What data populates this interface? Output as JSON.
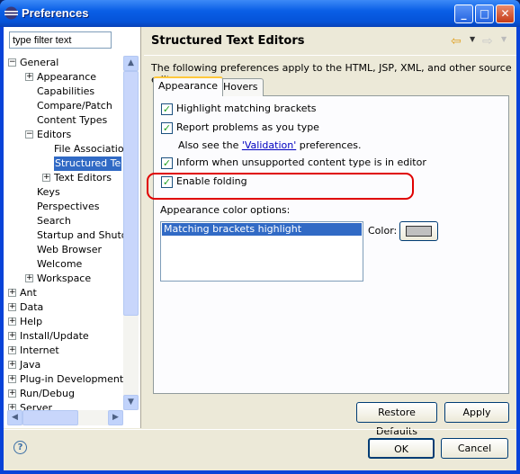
{
  "window": {
    "title": "Preferences",
    "minimize": "_",
    "maximize": "□",
    "close": "✕"
  },
  "sidebar": {
    "filter_placeholder": "type filter text",
    "tree": [
      {
        "label": "General",
        "expanded": true,
        "level": 0
      },
      {
        "label": "Appearance",
        "expandable": true,
        "level": 1
      },
      {
        "label": "Capabilities",
        "level": 1
      },
      {
        "label": "Compare/Patch",
        "level": 1
      },
      {
        "label": "Content Types",
        "level": 1
      },
      {
        "label": "Editors",
        "expanded": true,
        "level": 1
      },
      {
        "label": "File Associatio",
        "level": 2
      },
      {
        "label": "Structured Te",
        "level": 2,
        "selected": true
      },
      {
        "label": "Text Editors",
        "expandable": true,
        "level": 2
      },
      {
        "label": "Keys",
        "level": 1
      },
      {
        "label": "Perspectives",
        "level": 1
      },
      {
        "label": "Search",
        "level": 1
      },
      {
        "label": "Startup and Shutd",
        "level": 1
      },
      {
        "label": "Web Browser",
        "level": 1
      },
      {
        "label": "Welcome",
        "level": 1
      },
      {
        "label": "Workspace",
        "expandable": true,
        "level": 1
      },
      {
        "label": "Ant",
        "expandable": true,
        "level": 0
      },
      {
        "label": "Data",
        "expandable": true,
        "level": 0
      },
      {
        "label": "Help",
        "expandable": true,
        "level": 0
      },
      {
        "label": "Install/Update",
        "expandable": true,
        "level": 0
      },
      {
        "label": "Internet",
        "expandable": true,
        "level": 0
      },
      {
        "label": "Java",
        "expandable": true,
        "level": 0
      },
      {
        "label": "Plug-in Development",
        "expandable": true,
        "level": 0
      },
      {
        "label": "Run/Debug",
        "expandable": true,
        "level": 0
      },
      {
        "label": "Server",
        "expandable": true,
        "level": 0
      }
    ]
  },
  "page": {
    "title": "Structured Text Editors",
    "description": "The following preferences apply to the HTML, JSP, XML, and other source editors.",
    "tabs": [
      "Appearance",
      "Hovers"
    ],
    "options": [
      {
        "label": "Highlight matching brackets",
        "checked": true
      },
      {
        "label": "Report problems as you type",
        "checked": true
      },
      {
        "label": "Inform when unsupported content type is in editor",
        "checked": true
      },
      {
        "label": "Enable folding",
        "checked": true
      }
    ],
    "validation_prefix": "Also see the ",
    "validation_link": "'Validation'",
    "validation_suffix": " preferences.",
    "color_options_label": "Appearance color options:",
    "color_options": [
      "Matching brackets highlight"
    ],
    "color_label": "Color:",
    "color_value": "#c0c0c0",
    "restore_defaults": "Restore Defaults",
    "apply": "Apply"
  },
  "footer": {
    "ok": "OK",
    "cancel": "Cancel",
    "help": "?"
  },
  "colors": {
    "selection": "#316ac5",
    "highlight_annotation": "#e00000"
  }
}
